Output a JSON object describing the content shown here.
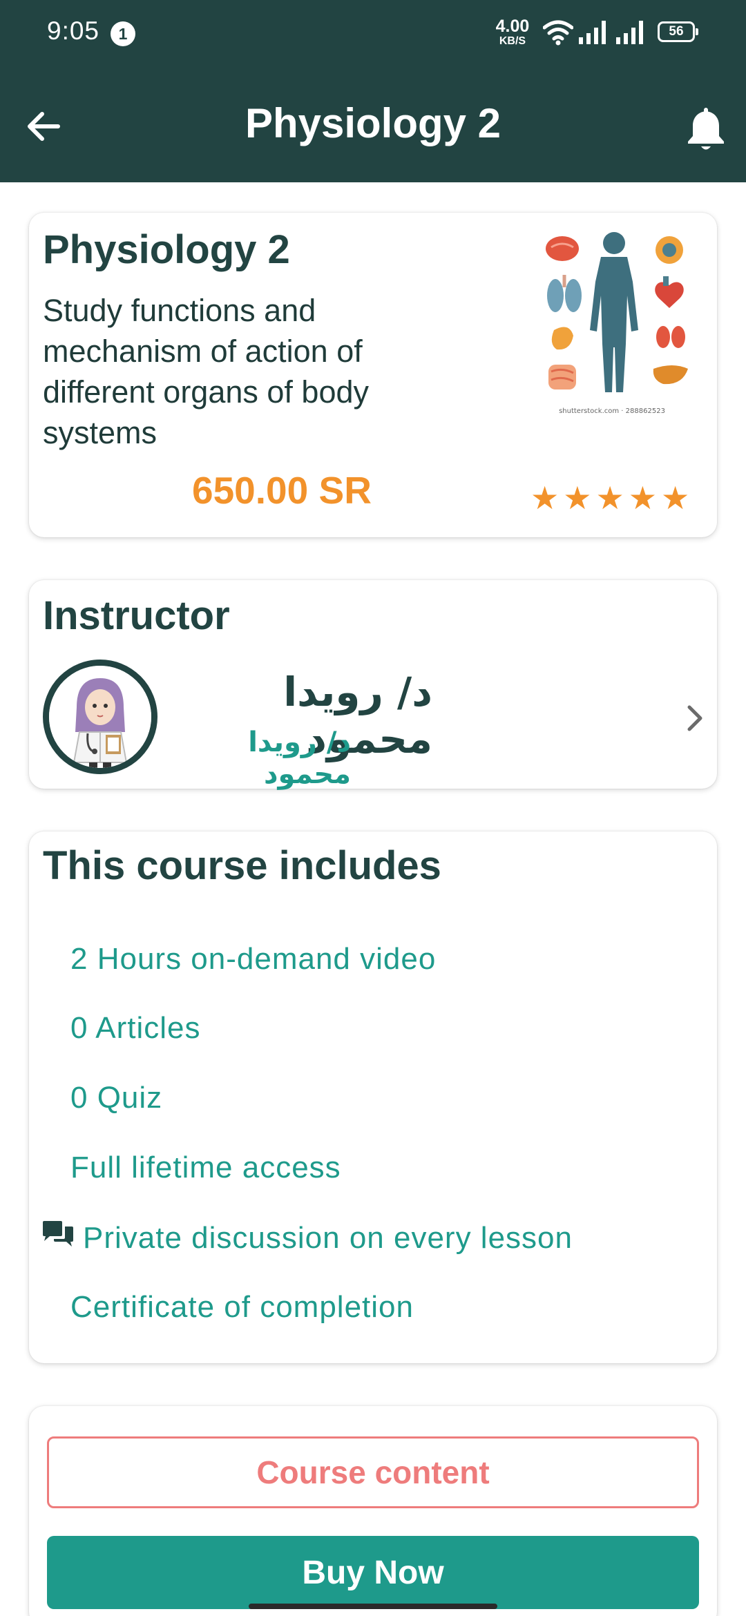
{
  "status_bar": {
    "time": "9:05",
    "notification_count": "1",
    "net_speed_value": "4.00",
    "net_speed_unit": "KB/S",
    "battery": "56"
  },
  "app_bar": {
    "title": "Physiology 2",
    "back_icon": "arrow-left-icon",
    "bell_icon": "bell-icon"
  },
  "course": {
    "title": "Physiology 2",
    "description": "Study functions and mechanism of action of different organs of body systems",
    "price": "650.00 SR",
    "rating": 5,
    "rating_max": 5,
    "image_watermark": "shutterstock.com · 288862523"
  },
  "instructor": {
    "section_title": "Instructor",
    "name": "د/ رويدا محمود",
    "subtitle": "د/ رويدا محمود",
    "chevron_icon": "chevron-right-icon"
  },
  "includes": {
    "section_title": "This course includes",
    "items": [
      "2 Hours on-demand video",
      "0 Articles",
      "0 Quiz",
      "Full lifetime access",
      "Private discussion on every lesson",
      "Certificate of completion"
    ],
    "discussion_icon": "chat-bubbles-icon"
  },
  "actions": {
    "course_content_label": "Course content",
    "buy_now_label": "Buy Now"
  },
  "colors": {
    "header": "#224442",
    "accent_teal": "#1e9a8b",
    "price_orange": "#f2922b",
    "outline_red": "#ee7c7c"
  }
}
